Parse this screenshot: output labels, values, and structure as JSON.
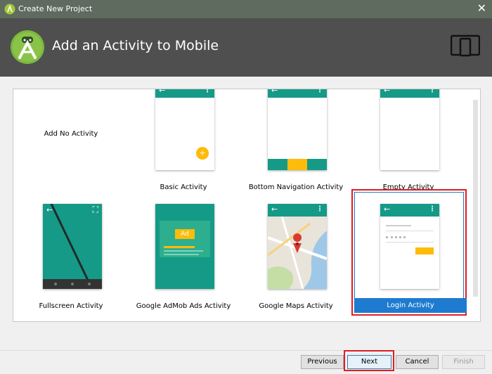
{
  "window": {
    "title": "Create New Project",
    "close_glyph": "✕"
  },
  "header": {
    "title": "Add an Activity to Mobile",
    "icon": "android-studio-icon",
    "devices_icon": "devices-icon"
  },
  "templates": [
    {
      "label": "Add No Activity"
    },
    {
      "label": "Basic Activity",
      "fab_glyph": "+"
    },
    {
      "label": "Bottom Navigation Activity"
    },
    {
      "label": "Empty Activity"
    },
    {
      "label": "Fullscreen Activity"
    },
    {
      "label": "Google AdMob Ads Activity",
      "ad_badge": "Ad"
    },
    {
      "label": "Google Maps Activity"
    },
    {
      "label": "Login Activity",
      "selected": true
    }
  ],
  "footer": {
    "previous": "Previous",
    "next": "Next",
    "cancel": "Cancel",
    "finish": "Finish"
  },
  "colors": {
    "teal": "#159a87",
    "amber": "#fdbb0a",
    "selection": "#1e7bd0",
    "highlight": "#e01d23"
  },
  "glyphs": {
    "back_arrow": "←",
    "menu": "⋮",
    "fullscreen": "⛶"
  }
}
